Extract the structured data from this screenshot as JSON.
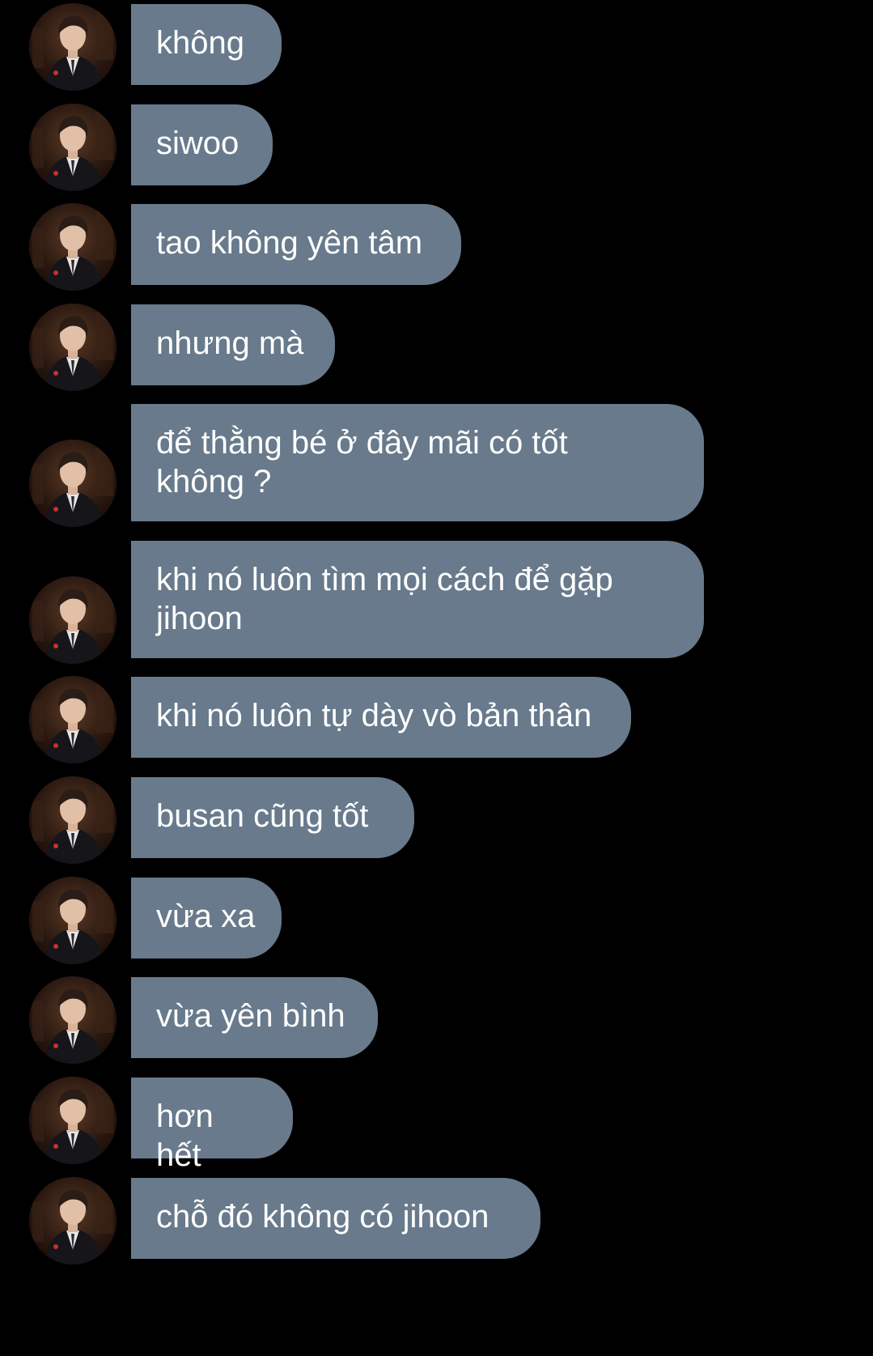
{
  "conversation": {
    "messages": [
      {
        "text": "không"
      },
      {
        "text": "siwoo"
      },
      {
        "text": "tao không yên tâm"
      },
      {
        "text": "nhưng mà"
      },
      {
        "text": "để thằng bé ở đây mãi có tốt\nkhông ?"
      },
      {
        "text": "khi nó luôn tìm mọi cách để gặp\njihoon"
      },
      {
        "text": "khi nó luôn tự dày vò bản thân"
      },
      {
        "text": "busan cũng tốt"
      },
      {
        "text": "vừa xa"
      },
      {
        "text": "vừa yên bình"
      },
      {
        "text": "hơn hết"
      },
      {
        "text": "chỗ đó không có jihoon"
      }
    ]
  },
  "colors": {
    "background": "#000000",
    "bubble": "#687a8b",
    "text": "#ffffff"
  },
  "icons": {
    "avatar": "profile-photo-avatar"
  }
}
